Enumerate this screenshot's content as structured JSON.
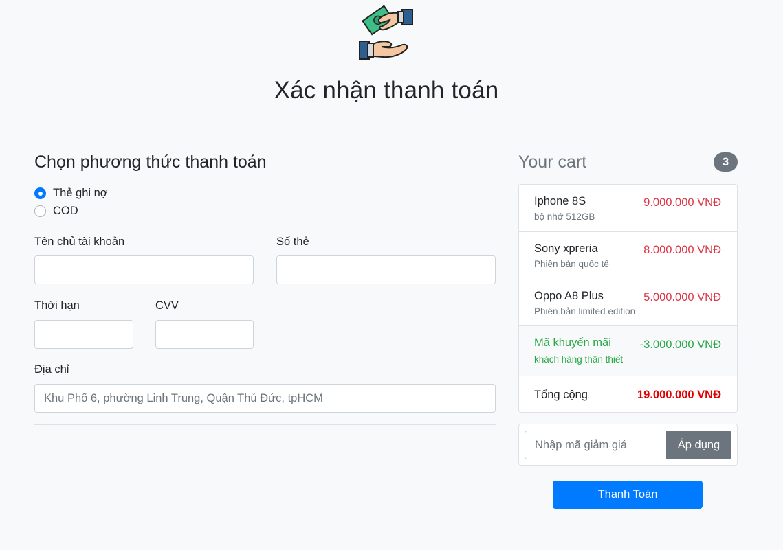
{
  "page": {
    "title": "Xác nhận thanh toán",
    "logo_icon": "hand-giving-money-icon"
  },
  "payment": {
    "section_title": "Chọn phương thức thanh toán",
    "methods": [
      {
        "label": "Thẻ ghi nợ",
        "checked": true
      },
      {
        "label": "COD",
        "checked": false
      }
    ],
    "fields": {
      "account_name": {
        "label": "Tên chủ tài khoản",
        "value": "",
        "placeholder": ""
      },
      "card_number": {
        "label": "Số thẻ",
        "value": "",
        "placeholder": ""
      },
      "expiry": {
        "label": "Thời hạn",
        "value": "",
        "placeholder": ""
      },
      "cvv": {
        "label": "CVV",
        "value": "",
        "placeholder": ""
      },
      "address": {
        "label": "Địa chỉ",
        "value": "",
        "placeholder": "Khu Phố 6, phường Linh Trung, Quận Thủ Đức, tpHCM"
      }
    }
  },
  "cart": {
    "title": "Your cart",
    "count": "3",
    "items": [
      {
        "name": "Iphone 8S",
        "desc": "bộ nhớ 512GB",
        "price": "9.000.000 VNĐ"
      },
      {
        "name": "Sony xpreria",
        "desc": "Phiên bản quốc tế",
        "price": "8.000.000 VNĐ"
      },
      {
        "name": "Oppo A8 Plus",
        "desc": "Phiên bản limited edition",
        "price": "5.000.000 VNĐ"
      }
    ],
    "promo": {
      "name": "Mã khuyến mãi",
      "desc": "khách hàng thân thiết",
      "price": "-3.000.000 VNĐ"
    },
    "total": {
      "label": "Tổng cộng",
      "value": "19.000.000 VNĐ"
    },
    "coupon": {
      "placeholder": "Nhập mã giảm giá",
      "value": "",
      "button_label": "Áp dụng"
    },
    "pay_button_label": "Thanh Toán"
  },
  "colors": {
    "primary": "#007bff",
    "secondary": "#6c757d",
    "price": "#dc3545",
    "promo": "#28a745",
    "total": "#e00000",
    "background": "#f8f9fa"
  }
}
